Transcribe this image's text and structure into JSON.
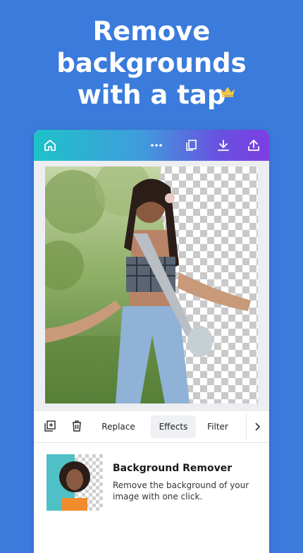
{
  "headline": {
    "line1": "Remove",
    "line2": "backgrounds",
    "line3": "with a tap"
  },
  "colors": {
    "background": "#3b7bdc",
    "crown": "#f4c542",
    "topbar_gradient": [
      "#1ec2c9",
      "#7d3fe2"
    ]
  },
  "topbar": {
    "icons": [
      "home-icon",
      "more-dots-icon",
      "copy-pages-icon",
      "download-icon",
      "share-upload-icon"
    ]
  },
  "toolbar": {
    "icons": [
      "duplicate-icon",
      "trash-icon"
    ],
    "tabs": [
      {
        "label": "Replace",
        "active": false
      },
      {
        "label": "Effects",
        "active": true
      },
      {
        "label": "Filter",
        "active": false
      }
    ],
    "next_icon": "chevron-right-icon"
  },
  "feature": {
    "title": "Background Remover",
    "description": "Remove the background of your image with one click."
  }
}
